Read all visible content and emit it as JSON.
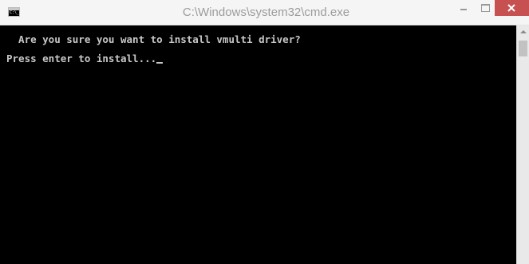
{
  "window": {
    "title": "C:\\Windows\\system32\\cmd.exe",
    "icon_label": "C:\\_",
    "icons": {
      "app": "cmd-icon",
      "minimize": "minimize-icon",
      "maximize": "maximize-icon",
      "close": "close-icon",
      "scroll_up": "scroll-up-arrow-icon"
    },
    "colors": {
      "close_button": "#c75050",
      "console_bg": "#000000",
      "console_text": "#c7c7c7"
    }
  },
  "console": {
    "lines": [
      "  Are you sure you want to install vmulti driver?",
      "Press enter to install..."
    ]
  }
}
